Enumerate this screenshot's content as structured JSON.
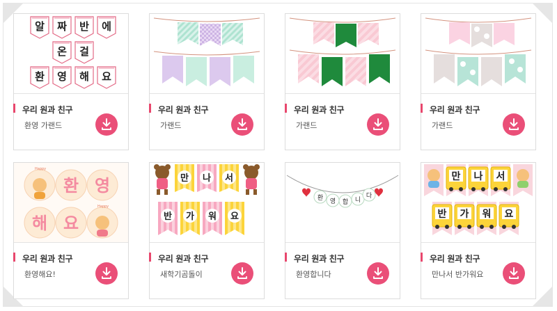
{
  "accent_color": "#ea4f78",
  "download_icon": "download-icon",
  "cards": [
    {
      "category": "우리 원과 친구",
      "name": "환영 가랜드",
      "thumb_text": [
        "알",
        "짜",
        "반",
        "에",
        "온",
        "걸",
        "환",
        "영",
        "해",
        "요"
      ]
    },
    {
      "category": "우리 원과 친구",
      "name": "가랜드"
    },
    {
      "category": "우리 원과 친구",
      "name": "가랜드"
    },
    {
      "category": "우리 원과 친구",
      "name": "가랜드"
    },
    {
      "category": "우리 원과 친구",
      "name": "환영해요!",
      "thumb_text": [
        "환",
        "영",
        "해",
        "요",
        "Happy",
        "Happy"
      ]
    },
    {
      "category": "우리 원과 친구",
      "name": "새학기곰돌이",
      "thumb_text": [
        "만",
        "나",
        "서",
        "반",
        "가",
        "워",
        "요"
      ]
    },
    {
      "category": "우리 원과 친구",
      "name": "환영합니다",
      "thumb_text": [
        "환",
        "영",
        "합",
        "니",
        "다"
      ]
    },
    {
      "category": "우리 원과 친구",
      "name": "만나서 반가워요",
      "thumb_text": [
        "만",
        "나",
        "서",
        "반",
        "가",
        "워",
        "요"
      ]
    }
  ]
}
